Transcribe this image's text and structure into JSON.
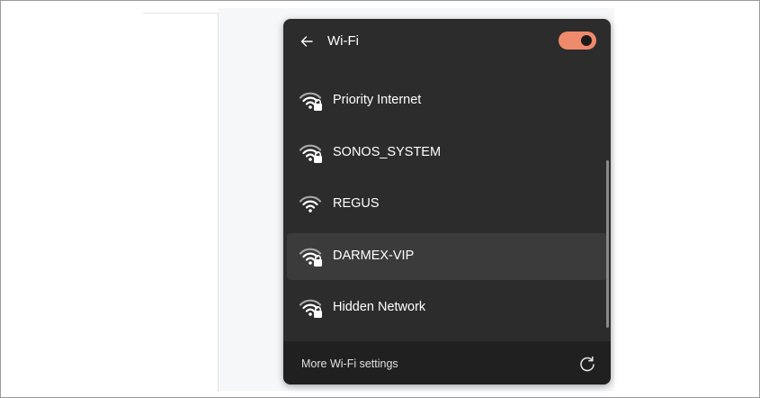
{
  "flyout": {
    "title": "Wi-Fi",
    "wifi_enabled": true,
    "accent_color": "#f08a6c",
    "back_icon": "arrow-left-icon"
  },
  "networks": [
    {
      "name": "Priority Internet",
      "secured": true,
      "selected": false
    },
    {
      "name": "SONOS_SYSTEM",
      "secured": true,
      "selected": false
    },
    {
      "name": "REGUS",
      "secured": false,
      "selected": false
    },
    {
      "name": "DARMEX-VIP",
      "secured": true,
      "selected": true
    },
    {
      "name": "Hidden Network",
      "secured": true,
      "selected": false
    }
  ],
  "footer": {
    "more_settings_label": "More Wi-Fi settings",
    "refresh_icon": "refresh-icon"
  }
}
